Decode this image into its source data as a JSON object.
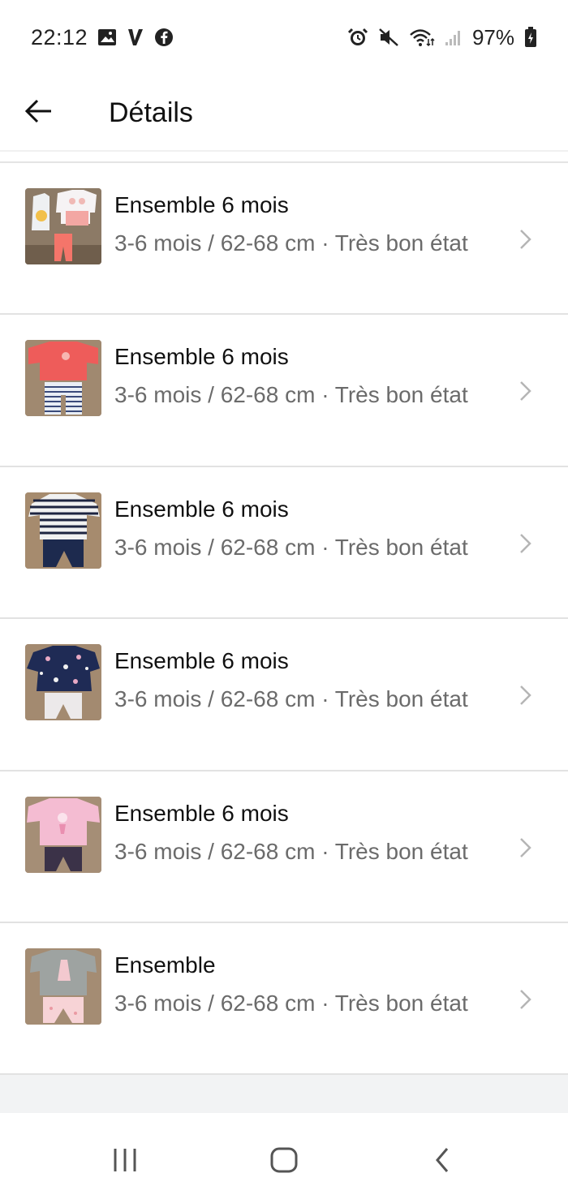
{
  "status_bar": {
    "time": "22:12",
    "battery": "97%",
    "left_icons": [
      "gallery-icon",
      "v-app-icon",
      "facebook-icon"
    ],
    "right_icons": [
      "alarm-icon",
      "mute-icon",
      "wifi-icon",
      "signal-icon",
      "battery-charging-icon"
    ]
  },
  "app_bar": {
    "title": "Détails",
    "back_icon": "arrow-left-icon"
  },
  "items": [
    {
      "title": "Ensemble 6 mois",
      "subtitle": "3-6 mois / 62-68 cm · Très bon état"
    },
    {
      "title": "Ensemble 6 mois",
      "subtitle": "3-6 mois / 62-68 cm · Très bon état"
    },
    {
      "title": "Ensemble 6 mois",
      "subtitle": "3-6 mois / 62-68 cm · Très bon état"
    },
    {
      "title": "Ensemble 6 mois",
      "subtitle": "3-6 mois / 62-68 cm · Très bon état"
    },
    {
      "title": "Ensemble 6 mois",
      "subtitle": "3-6 mois / 62-68 cm · Très bon état"
    },
    {
      "title": "Ensemble",
      "subtitle": "3-6 mois / 62-68 cm · Très bon état"
    }
  ],
  "nav_bar": {
    "buttons": [
      "recent-apps-icon",
      "home-icon",
      "back-icon"
    ]
  },
  "colors": {
    "text_primary": "#111111",
    "text_secondary": "#6b6b6b",
    "divider": "#e2e2e2",
    "chevron": "#b5b5b5"
  }
}
